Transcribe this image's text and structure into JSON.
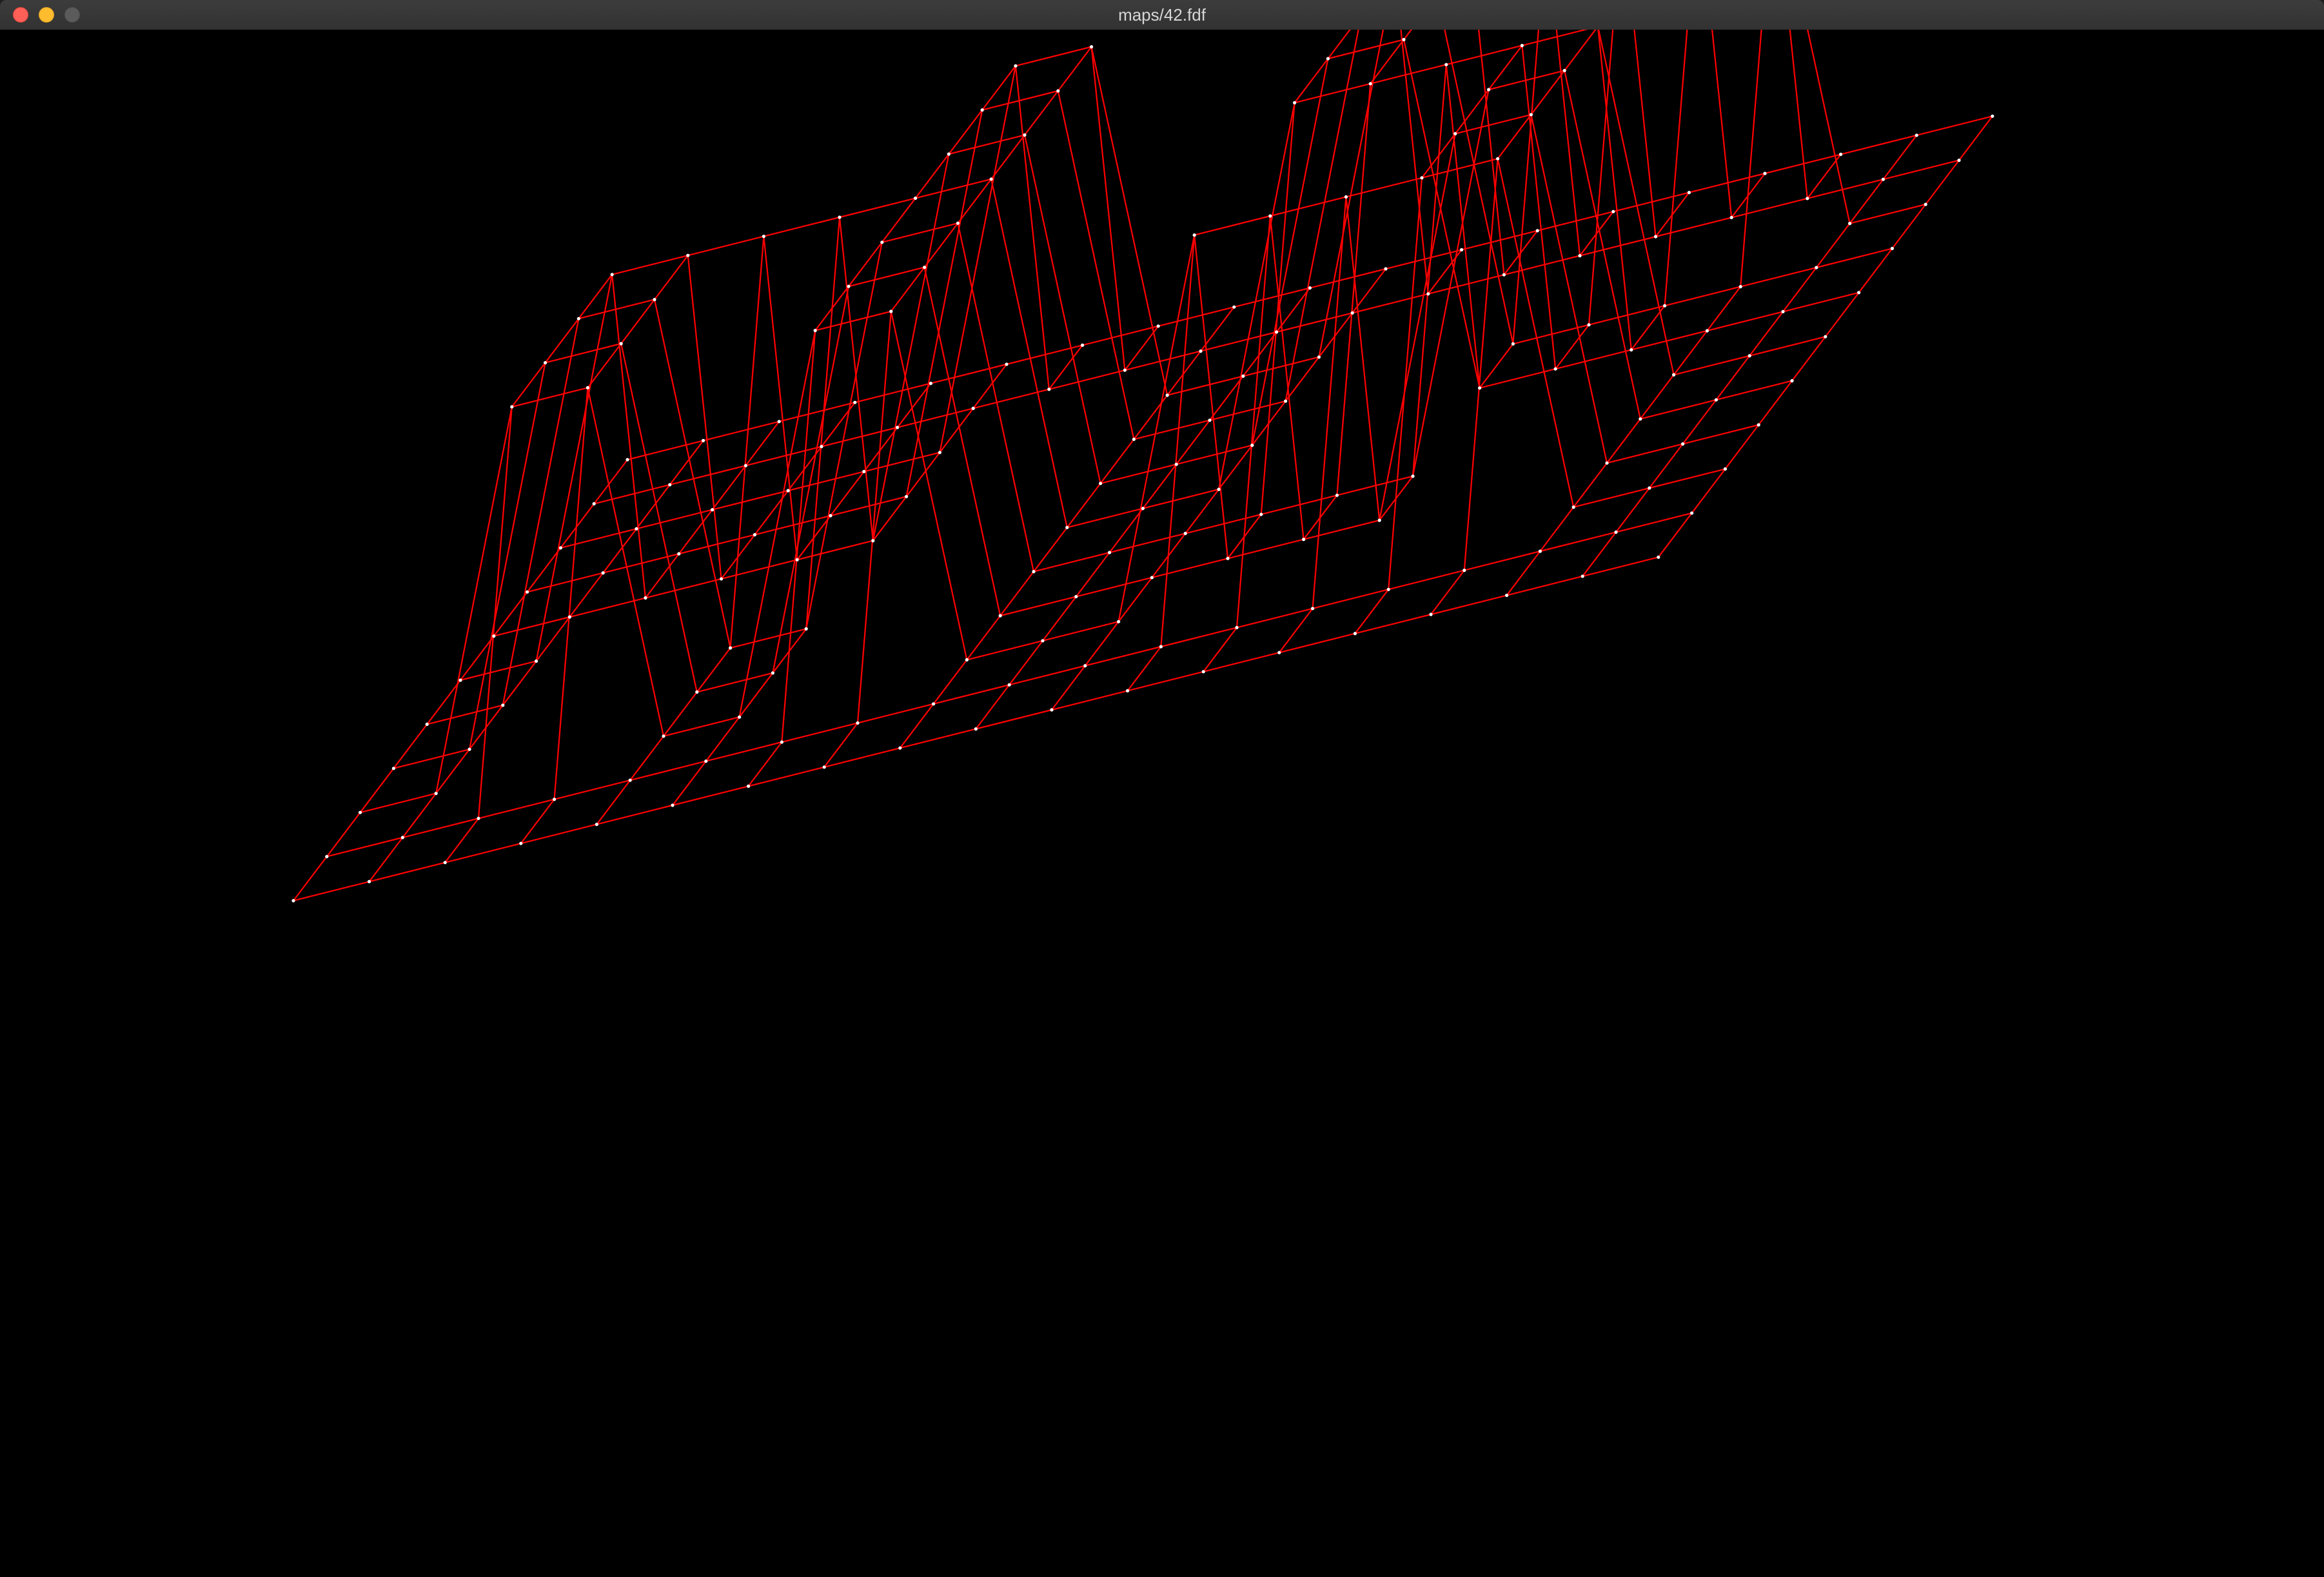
{
  "window": {
    "title": "maps/42.fdf"
  },
  "controls": {
    "close_icon": "close-icon",
    "minimize_icon": "minimize-icon",
    "zoom_icon": "zoom-icon"
  },
  "colors": {
    "background": "#000000",
    "wire": "#ff0000",
    "vertex": "#ffffff"
  },
  "map": {
    "name": "42",
    "heights": [
      [
        0,
        0,
        0,
        0,
        0,
        0,
        0,
        0,
        0,
        0,
        0,
        0,
        0,
        0,
        0,
        0,
        0,
        0,
        0
      ],
      [
        0,
        0,
        0,
        0,
        0,
        0,
        0,
        0,
        0,
        0,
        0,
        0,
        0,
        0,
        0,
        0,
        0,
        0,
        0
      ],
      [
        0,
        0,
        10,
        10,
        0,
        0,
        10,
        10,
        0,
        0,
        0,
        10,
        10,
        10,
        10,
        10,
        0,
        0,
        0
      ],
      [
        0,
        0,
        10,
        10,
        0,
        0,
        10,
        10,
        0,
        0,
        0,
        0,
        0,
        0,
        10,
        10,
        0,
        0,
        0
      ],
      [
        0,
        0,
        10,
        10,
        0,
        0,
        10,
        10,
        0,
        0,
        0,
        0,
        0,
        0,
        10,
        10,
        0,
        0,
        0
      ],
      [
        0,
        0,
        10,
        10,
        10,
        10,
        10,
        10,
        0,
        0,
        0,
        10,
        10,
        10,
        10,
        10,
        0,
        0,
        0
      ],
      [
        0,
        0,
        0,
        0,
        0,
        0,
        10,
        10,
        0,
        0,
        0,
        10,
        10,
        0,
        0,
        0,
        0,
        0,
        0
      ],
      [
        0,
        0,
        0,
        0,
        0,
        0,
        10,
        10,
        0,
        0,
        0,
        10,
        10,
        0,
        0,
        0,
        0,
        0,
        0
      ],
      [
        0,
        0,
        0,
        0,
        0,
        0,
        10,
        10,
        0,
        0,
        0,
        10,
        10,
        10,
        10,
        10,
        10,
        0,
        0
      ],
      [
        0,
        0,
        0,
        0,
        0,
        0,
        0,
        0,
        0,
        0,
        0,
        0,
        0,
        0,
        0,
        0,
        0,
        0,
        0
      ],
      [
        0,
        0,
        0,
        0,
        0,
        0,
        0,
        0,
        0,
        0,
        0,
        0,
        0,
        0,
        0,
        0,
        0,
        0,
        0
      ]
    ]
  }
}
